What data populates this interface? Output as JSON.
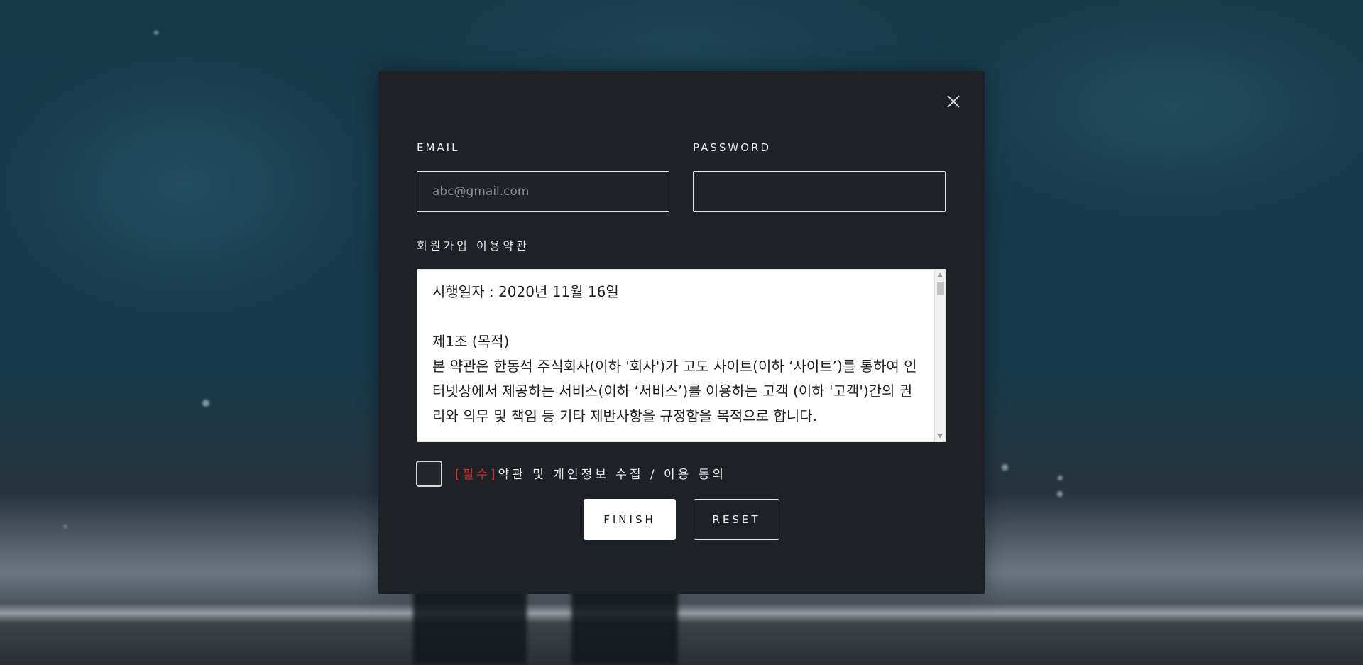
{
  "form": {
    "email_label": "EMAIL",
    "email_placeholder": "abc@gmail.com",
    "email_value": "",
    "password_label": "PASSWORD",
    "password_value": ""
  },
  "terms": {
    "title": "회원가입 이용약관",
    "line1": "시행일자 : 2020년 11월 16일",
    "line2": "제1조 (목적)",
    "line3": "본 약관은 한동석 주식회사(이하 '회사')가 고도 사이트(이하 ‘사이트’)를 통하여 인터넷상에서 제공하는 서비스(이하 ‘서비스’)를 이용하는 고객 (이하 '고객')간의 권리와 의무 및 책임 등 기타 제반사항을 규정함을 목적으로 합니다."
  },
  "agreement": {
    "required_tag": "[필수]",
    "text": "약관 및 개인정보 수집 / 이용 동의",
    "checked": false
  },
  "buttons": {
    "finish": "FINISH",
    "reset": "RESET"
  },
  "icons": {
    "close": "close-icon",
    "scroll_up": "scroll-up-arrow",
    "scroll_down": "scroll-down-arrow"
  },
  "colors": {
    "modal_bg": "#1e2226",
    "required_accent": "#d92a2a",
    "finish_bg": "#ffffff"
  }
}
